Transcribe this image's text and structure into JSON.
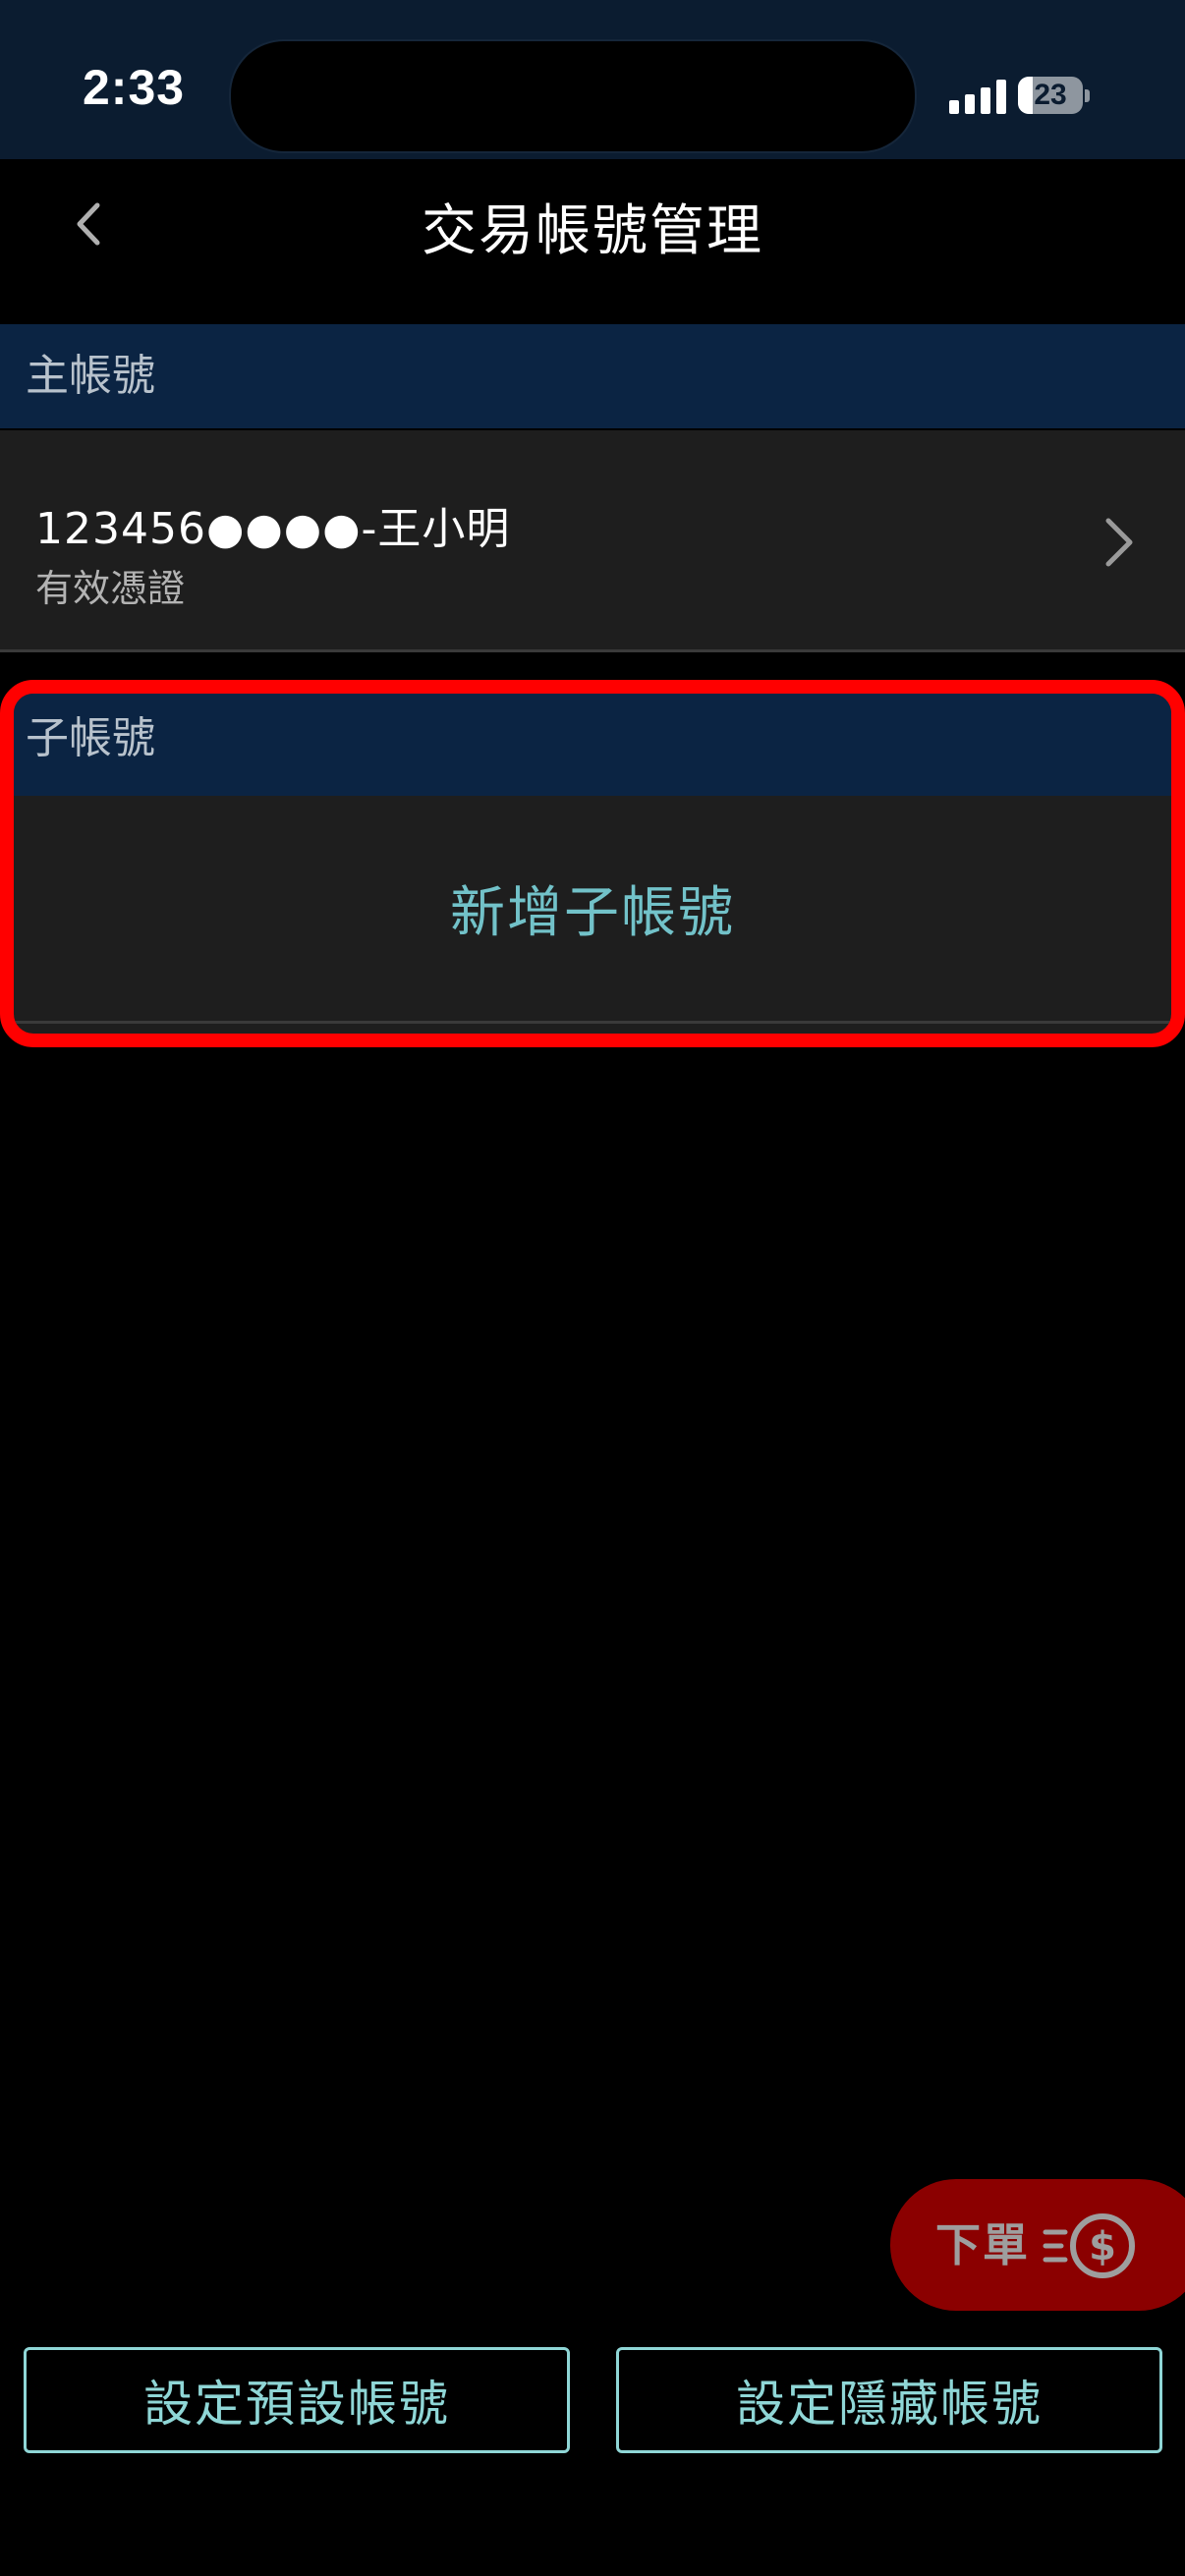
{
  "status_bar": {
    "time": "2:33",
    "battery": "23",
    "battery_level": 0.23
  },
  "nav": {
    "title": "交易帳號管理"
  },
  "main_account": {
    "header": "主帳號",
    "account_label": "123456●●●●-王小明",
    "status": "有效憑證"
  },
  "sub_account": {
    "header": "子帳號",
    "add_label": "新增子帳號"
  },
  "fab": {
    "label": "下單"
  },
  "bottom_buttons": {
    "set_default": "設定預設帳號",
    "set_hidden": "設定隱藏帳號"
  },
  "colors": {
    "header_bg": "#0b2443",
    "status_bg": "#0b1c30",
    "accent": "#72c2c9",
    "highlight": "#ff0000",
    "fab": "#8b0000"
  }
}
